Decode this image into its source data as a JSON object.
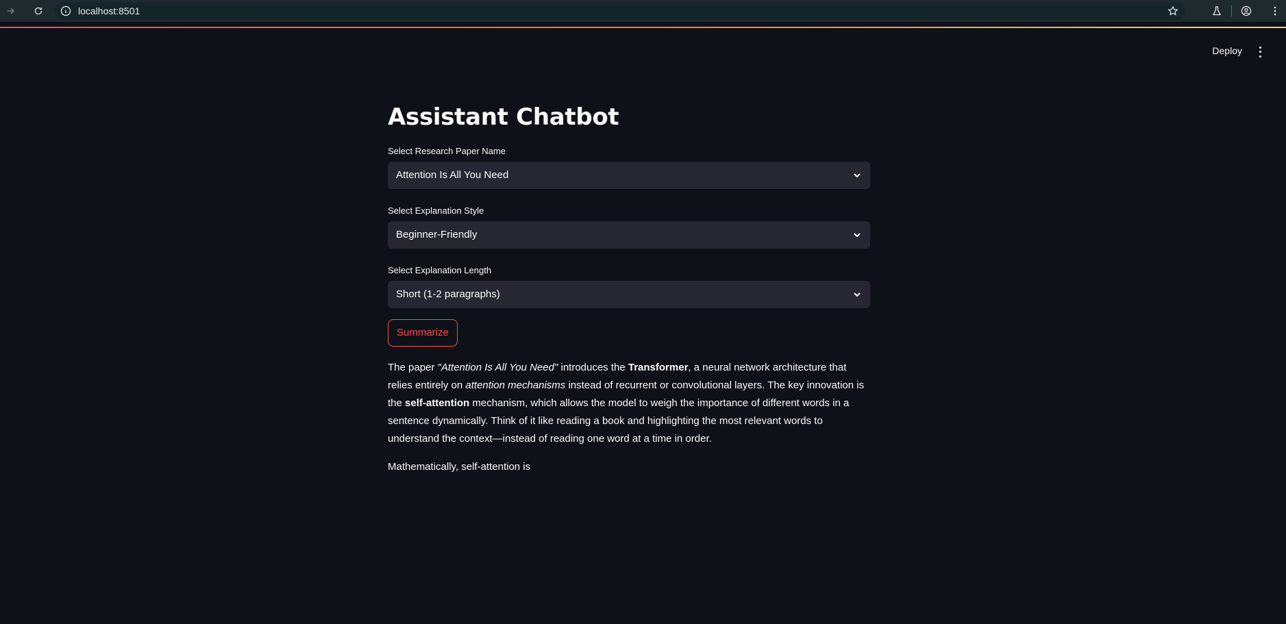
{
  "browser": {
    "url": "localhost:8501"
  },
  "header": {
    "deploy_label": "Deploy"
  },
  "main": {
    "title": "Assistant Chatbot",
    "paper_select": {
      "label": "Select Research Paper Name",
      "value": "Attention Is All You Need"
    },
    "style_select": {
      "label": "Select Explanation Style",
      "value": "Beginner-Friendly"
    },
    "length_select": {
      "label": "Select Explanation Length",
      "value": "Short (1-2 paragraphs)"
    },
    "summarize_label": "Summarize",
    "summary": {
      "p1_a": "The paper ",
      "p1_b": "\"Attention Is All You Need\"",
      "p1_c": " introduces the ",
      "p1_d": "Transformer",
      "p1_e": ", a neural network architecture that relies entirely on ",
      "p1_f": "attention mechanisms",
      "p1_g": " instead of recurrent or convolutional layers. The key innovation is the ",
      "p1_h": "self-attention",
      "p1_i": " mechanism, which allows the model to weigh the importance of different words in a sentence dynamically. Think of it like reading a book and highlighting the most relevant words to understand the context—instead of reading one word at a time in order.",
      "p2": "Mathematically, self-attention is"
    }
  },
  "colors": {
    "accent": "#ff4b4b",
    "background": "#0e1117",
    "select_bg": "#262730"
  }
}
